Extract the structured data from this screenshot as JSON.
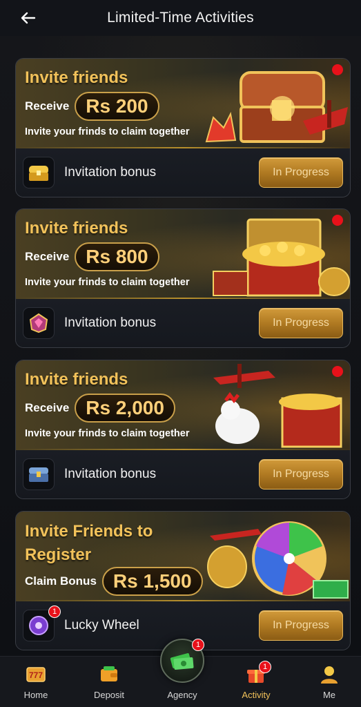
{
  "header": {
    "title": "Limited-Time Activities"
  },
  "cards": [
    {
      "title": "Invite friends",
      "receive_label": "Receive",
      "amount": "Rs 200",
      "subtitle": "Invite your frinds to claim together",
      "bonus_label": "Invitation bonus",
      "button_label": "In Progress",
      "icon": "treasure-chest-icon"
    },
    {
      "title": "Invite friends",
      "receive_label": "Receive",
      "amount": "Rs 800",
      "subtitle": "Invite your frinds to claim together",
      "bonus_label": "Invitation bonus",
      "button_label": "In Progress",
      "icon": "gem-icon"
    },
    {
      "title": "Invite friends",
      "receive_label": "Receive",
      "amount": "Rs 2,000",
      "subtitle": "Invite your frinds to claim together",
      "bonus_label": "Invitation bonus",
      "button_label": "In Progress",
      "icon": "chest-icon"
    },
    {
      "title": "Invite Friends to Register",
      "receive_label": "Claim Bonus",
      "amount": "Rs 1,500",
      "bonus_label": "Lucky Wheel",
      "badge": "1",
      "button_label": "In Progress",
      "icon": "wheel-icon"
    }
  ],
  "nav": {
    "home": "Home",
    "deposit": "Deposit",
    "agency": "Agency",
    "agency_badge": "1",
    "activity": "Activity",
    "activity_badge": "1",
    "me": "Me"
  },
  "colors": {
    "gold": "#f2c25a",
    "red_dot": "#e8111a",
    "button": "#b07a22"
  }
}
